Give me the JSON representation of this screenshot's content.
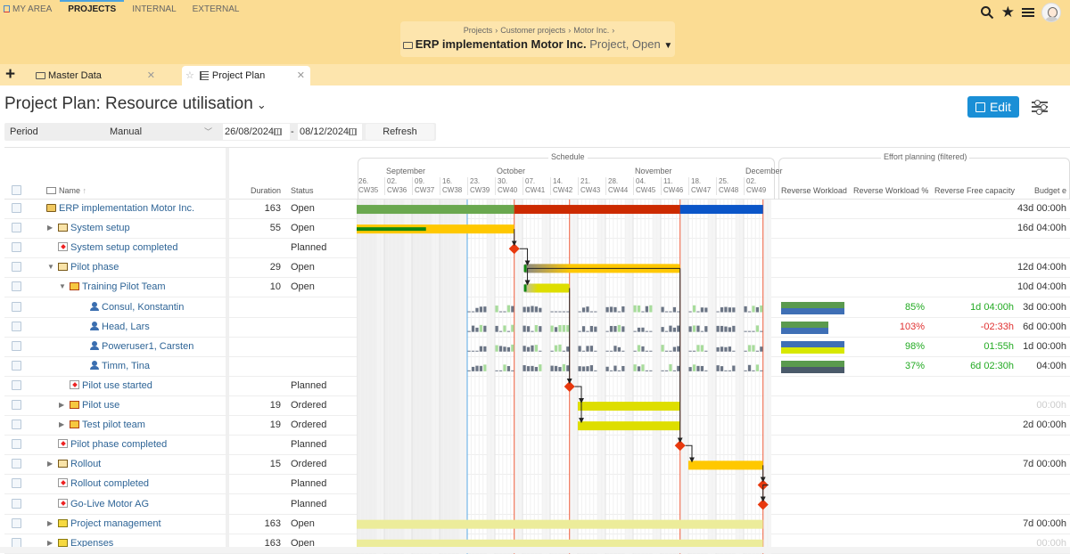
{
  "topnav": {
    "items": [
      {
        "label": "MY AREA",
        "active": false
      },
      {
        "label": "PROJECTS",
        "active": true
      },
      {
        "label": "INTERNAL",
        "active": false
      },
      {
        "label": "EXTERNAL",
        "active": false
      }
    ],
    "icons": [
      "search-icon",
      "star-icon",
      "menu-icon",
      "user-avatar"
    ]
  },
  "breadcrumb": {
    "items": [
      "Projects",
      "Customer projects",
      "Motor Inc."
    ],
    "title": "ERP implementation Motor Inc.",
    "subtitle": "Project, Open"
  },
  "tabs": [
    {
      "label": "Master Data",
      "active": false
    },
    {
      "label": "Project Plan",
      "active": true
    }
  ],
  "page": {
    "title": "Project Plan: Resource utilisation",
    "edit_label": "Edit"
  },
  "filter": {
    "label": "Period",
    "mode": "Manual",
    "date_from": "26/08/2024",
    "date_to": "08/12/2024",
    "refresh_label": "Refresh"
  },
  "columns": {
    "name": "Name",
    "duration": "Duration",
    "status": "Status",
    "schedule_group": "Schedule",
    "effort_group": "Effort planning (filtered)",
    "reverse_workload": "Reverse Workload",
    "reverse_workload_pct": "Reverse Workload %",
    "reverse_free_capacity": "Reverse Free capacity",
    "budget": "Budget e"
  },
  "timeline": {
    "months": [
      {
        "label": "September",
        "week_index": 1
      },
      {
        "label": "October",
        "week_index": 5
      },
      {
        "label": "November",
        "week_index": 10
      },
      {
        "label": "December",
        "week_index": 14
      }
    ],
    "weeks": [
      {
        "day": "26.",
        "cw": "CW35"
      },
      {
        "day": "02.",
        "cw": "CW36"
      },
      {
        "day": "09.",
        "cw": "CW37"
      },
      {
        "day": "16.",
        "cw": "CW38"
      },
      {
        "day": "23.",
        "cw": "CW39"
      },
      {
        "day": "30.",
        "cw": "CW40"
      },
      {
        "day": "07.",
        "cw": "CW41"
      },
      {
        "day": "14.",
        "cw": "CW42"
      },
      {
        "day": "21.",
        "cw": "CW43"
      },
      {
        "day": "28.",
        "cw": "CW44"
      },
      {
        "day": "04.",
        "cw": "CW45"
      },
      {
        "day": "11.",
        "cw": "CW46"
      },
      {
        "day": "18.",
        "cw": "CW47"
      },
      {
        "day": "25.",
        "cw": "CW48"
      },
      {
        "day": "02.",
        "cw": "CW49"
      }
    ],
    "today_week": 4.0,
    "markers_week": [
      5.7,
      7.7,
      11.7,
      14.7
    ]
  },
  "rows": [
    {
      "name": "ERP implementation Motor Inc.",
      "level": 0,
      "icon": "project-folder-icon",
      "expander": "none",
      "duration": "163",
      "status": "Open",
      "budget": "43d 00:00h",
      "bars": [
        {
          "start": 0,
          "end": 5.7,
          "color": "#6aa84f"
        },
        {
          "start": 5.7,
          "end": 11.7,
          "color": "#cc2a00"
        },
        {
          "start": 11.7,
          "end": 14.7,
          "color": "#0a55c8"
        }
      ]
    },
    {
      "name": "System setup",
      "level": 1,
      "icon": "folder-icon",
      "expander": "collapsed",
      "duration": "55",
      "status": "Open",
      "budget": "16d 04:00h",
      "bars": [
        {
          "start": 0,
          "end": 5.7,
          "color": "#ffc800",
          "progress": 0.44
        }
      ]
    },
    {
      "name": "System setup completed",
      "level": 1,
      "icon": "milestone-icon",
      "expander": "none",
      "duration": "",
      "status": "Planned",
      "budget": "",
      "milestone": 5.7
    },
    {
      "name": "Pilot phase",
      "level": 1,
      "icon": "folder-icon",
      "expander": "expanded",
      "duration": "29",
      "status": "Open",
      "budget": "12d 04:00h",
      "bars": [
        {
          "start": 6.05,
          "end": 11.7,
          "color": "#ffc800",
          "gradient": true
        }
      ]
    },
    {
      "name": "Training Pilot Team",
      "level": 2,
      "icon": "task-folder-icon",
      "expander": "expanded",
      "duration": "10",
      "status": "Open",
      "budget": "10d 04:00h",
      "bars": [
        {
          "start": 6.05,
          "end": 7.7,
          "color": "#dede00",
          "gradient": true
        }
      ]
    },
    {
      "name": "Consul, Konstantin",
      "level": 3,
      "icon": "person-icon",
      "expander": "none",
      "duration": "",
      "status": "",
      "budget": "3d 00:00h",
      "workload": {
        "pct": "85%",
        "pct_color": "green",
        "free": "1d 04:00h",
        "free_color": "green",
        "bar_colors": [
          "#5a9a4e",
          "#3f6fb5"
        ],
        "fill": 1.0
      }
    },
    {
      "name": "Head, Lars",
      "level": 3,
      "icon": "person-icon",
      "expander": "none",
      "duration": "",
      "status": "",
      "budget": "6d 00:00h",
      "workload": {
        "pct": "103%",
        "pct_color": "red",
        "free": "-02:33h",
        "free_color": "red",
        "bar_colors": [
          "#5a9a4e",
          "#3f6fb5"
        ],
        "fill": 0.75
      }
    },
    {
      "name": "Poweruser1, Carsten",
      "level": 3,
      "icon": "person-icon",
      "expander": "none",
      "duration": "",
      "status": "",
      "budget": "1d 00:00h",
      "workload": {
        "pct": "98%",
        "pct_color": "green",
        "free": "01:55h",
        "free_color": "green",
        "bar_colors": [
          "#3f6fb5",
          "#d8e800"
        ],
        "fill": 1.0
      }
    },
    {
      "name": "Timm, Tina",
      "level": 3,
      "icon": "person-icon",
      "expander": "none",
      "duration": "",
      "status": "",
      "budget": "04:00h",
      "workload": {
        "pct": "37%",
        "pct_color": "green",
        "free": "6d 02:30h",
        "free_color": "green",
        "bar_colors": [
          "#5a9a4e",
          "#4a5a6a"
        ],
        "fill": 1.0
      }
    },
    {
      "name": "Pilot use started",
      "level": 2,
      "icon": "milestone-icon",
      "expander": "none",
      "duration": "",
      "status": "Planned",
      "budget": "",
      "milestone": 7.7
    },
    {
      "name": "Pilot use",
      "level": 2,
      "icon": "task-folder-icon",
      "expander": "collapsed",
      "duration": "19",
      "status": "Ordered",
      "budget": "00:00h",
      "budget_muted": true,
      "bars": [
        {
          "start": 8.0,
          "end": 11.7,
          "color": "#dede00"
        }
      ]
    },
    {
      "name": "Test pilot team",
      "level": 2,
      "icon": "task-folder-icon",
      "expander": "collapsed",
      "duration": "19",
      "status": "Ordered",
      "budget": "2d 00:00h",
      "bars": [
        {
          "start": 8.0,
          "end": 11.7,
          "color": "#dede00"
        }
      ]
    },
    {
      "name": "Pilot phase completed",
      "level": 1,
      "icon": "milestone-icon",
      "expander": "none",
      "duration": "",
      "status": "Planned",
      "budget": "",
      "milestone": 11.7
    },
    {
      "name": "Rollout",
      "level": 1,
      "icon": "folder-icon",
      "expander": "collapsed",
      "duration": "15",
      "status": "Ordered",
      "budget": "7d 00:00h",
      "bars": [
        {
          "start": 12.0,
          "end": 14.7,
          "color": "#ffc800"
        }
      ]
    },
    {
      "name": "Rollout completed",
      "level": 1,
      "icon": "milestone-icon",
      "expander": "none",
      "duration": "",
      "status": "Planned",
      "budget": "",
      "milestone": 14.7
    },
    {
      "name": "Go-Live Motor AG",
      "level": 1,
      "icon": "milestone-icon",
      "expander": "none",
      "duration": "",
      "status": "Planned",
      "budget": "",
      "milestone": 14.7
    },
    {
      "name": "Project management",
      "level": 1,
      "icon": "group-folder-icon",
      "expander": "collapsed",
      "duration": "163",
      "status": "Open",
      "budget": "7d 00:00h",
      "bars": [
        {
          "start": 0,
          "end": 14.7,
          "color": "#ecec9a"
        }
      ]
    },
    {
      "name": "Expenses",
      "level": 1,
      "icon": "group-folder-icon",
      "expander": "collapsed",
      "duration": "163",
      "status": "Open",
      "budget": "00:00h",
      "budget_muted": true,
      "bars": [
        {
          "start": 0,
          "end": 14.7,
          "color": "#ecec9a"
        }
      ]
    }
  ],
  "dependencies": [
    [
      1,
      2
    ],
    [
      2,
      3
    ],
    [
      3,
      4
    ],
    [
      4,
      9
    ],
    [
      9,
      10
    ],
    [
      9,
      11
    ],
    [
      3,
      12
    ],
    [
      12,
      13
    ],
    [
      13,
      14
    ],
    [
      14,
      15
    ]
  ]
}
